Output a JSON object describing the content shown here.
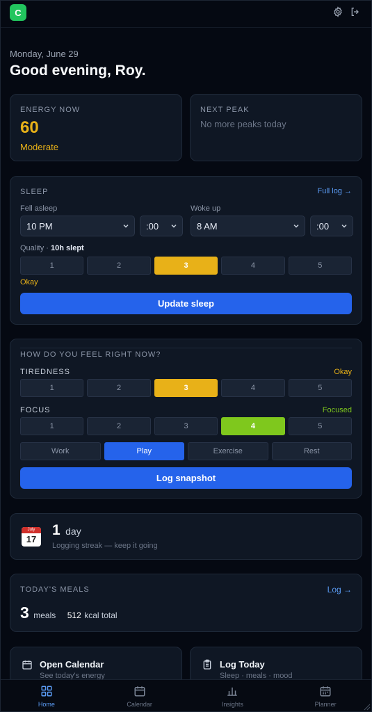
{
  "app": {
    "logo_letter": "C"
  },
  "header": {
    "date": "Monday, June 29",
    "greeting": "Good evening, Roy."
  },
  "energy": {
    "label": "ENERGY NOW",
    "value": "60",
    "level": "Moderate"
  },
  "next_peak": {
    "label": "NEXT PEAK",
    "text": "No more peaks today"
  },
  "sleep": {
    "label": "SLEEP",
    "full_log": "Full log →",
    "fell_asleep_label": "Fell asleep",
    "fell_asleep_hour": "10 PM",
    "fell_asleep_min": ":00",
    "woke_up_label": "Woke up",
    "woke_up_hour": "8 AM",
    "woke_up_min": ":00",
    "quality_label": "Quality ·",
    "hours_slept": "10h slept",
    "quality_options": [
      "1",
      "2",
      "3",
      "4",
      "5"
    ],
    "quality_selected": 3,
    "quality_text": "Okay",
    "update_button": "Update sleep"
  },
  "feel": {
    "label": "HOW DO YOU FEEL RIGHT NOW?",
    "tiredness_label": "TIREDNESS",
    "tiredness_status": "Okay",
    "tiredness_options": [
      "1",
      "2",
      "3",
      "4",
      "5"
    ],
    "tiredness_selected": 3,
    "focus_label": "FOCUS",
    "focus_status": "Focused",
    "focus_options": [
      "1",
      "2",
      "3",
      "4",
      "5"
    ],
    "focus_selected": 4,
    "activities": [
      "Work",
      "Play",
      "Exercise",
      "Rest"
    ],
    "activity_selected": "Play",
    "log_button": "Log snapshot"
  },
  "streak": {
    "calendar_month": "July",
    "calendar_day": "17",
    "count": "1",
    "unit": "day",
    "text": "Logging streak — keep it going"
  },
  "meals": {
    "label": "TODAY'S MEALS",
    "log_link": "Log →",
    "count": "3",
    "unit": "meals",
    "kcal": "512",
    "kcal_unit": "kcal total"
  },
  "shortcuts": [
    {
      "title": "Open Calendar",
      "subtitle": "See today's energy"
    },
    {
      "title": "Log Today",
      "subtitle": "Sleep · meals · mood"
    }
  ],
  "nav": [
    {
      "label": "Home",
      "icon": "grid-icon"
    },
    {
      "label": "Calendar",
      "icon": "calendar-icon"
    },
    {
      "label": "Insights",
      "icon": "bar-chart-icon"
    },
    {
      "label": "Planner",
      "icon": "planner-icon"
    }
  ],
  "colors": {
    "accent": "#2563eb",
    "amber": "#e8b118",
    "green": "#7fc81d",
    "link": "#5b9cf5"
  }
}
